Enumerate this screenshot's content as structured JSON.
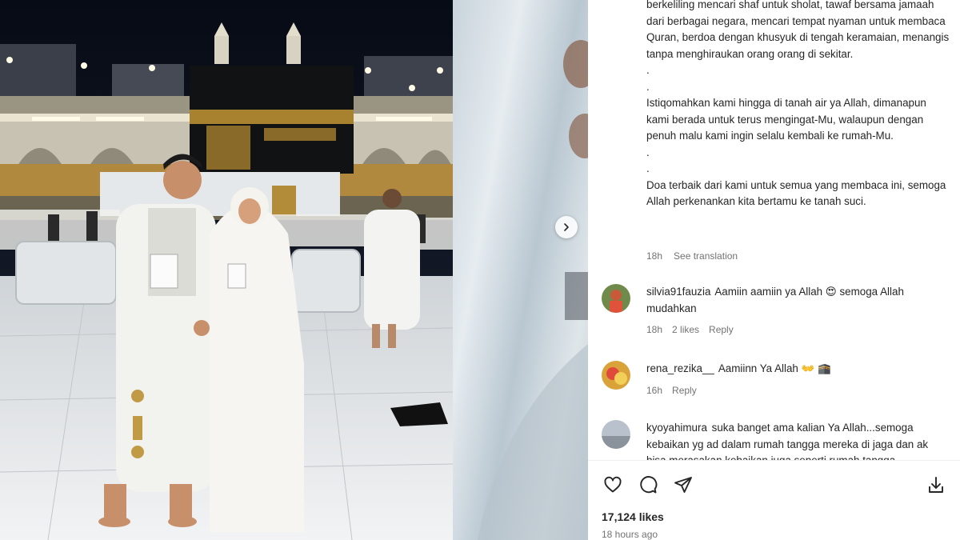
{
  "caption": {
    "lines": [
      "berkeliling mencari shaf untuk sholat, tawaf bersama jamaah dari berbagai negara, mencari tempat nyaman untuk membaca Quran, berdoa dengan khusyuk di tengah keramaian, menangis tanpa menghiraukan orang orang di sekitar.",
      ".",
      ".",
      "Istiqomahkan kami hingga di tanah air ya Allah, dimanapun kami berada untuk terus mengingat-Mu, walaupun dengan penuh malu kami ingin selalu kembali ke rumah-Mu.",
      ".",
      ".",
      "Doa terbaik dari kami untuk semua yang membaca ini, semoga Allah perkenankan kita bertamu ke tanah suci."
    ],
    "time": "18h",
    "translate": "See translation"
  },
  "comments": [
    {
      "username": "silvia91fauzia",
      "text": "Aamiin aamiin ya Allah 😍 semoga Allah mudahkan",
      "time": "18h",
      "likes": "2 likes",
      "reply": "Reply"
    },
    {
      "username": "rena_rezika__",
      "text": "Aamiinn Ya Allah 👐 🕋",
      "time": "16h",
      "reply": "Reply"
    },
    {
      "username": "kyoyahimura",
      "text": "suka banget ama kalian Ya Allah...semoga kebaikan yg ad dalam rumah tangga mereka di jaga dan ak bisa merasakan kebaikan juga seperti rumah tangga"
    }
  ],
  "post": {
    "likes": "17,124 likes",
    "time": "18 hours ago"
  },
  "icons": {
    "like": "heart-icon",
    "comment": "comment-icon",
    "share": "send-icon",
    "save": "save-download-icon",
    "next": "chevron-right-icon"
  },
  "colors": {
    "text": "#262626",
    "muted": "#737373",
    "divider": "#efefef"
  }
}
